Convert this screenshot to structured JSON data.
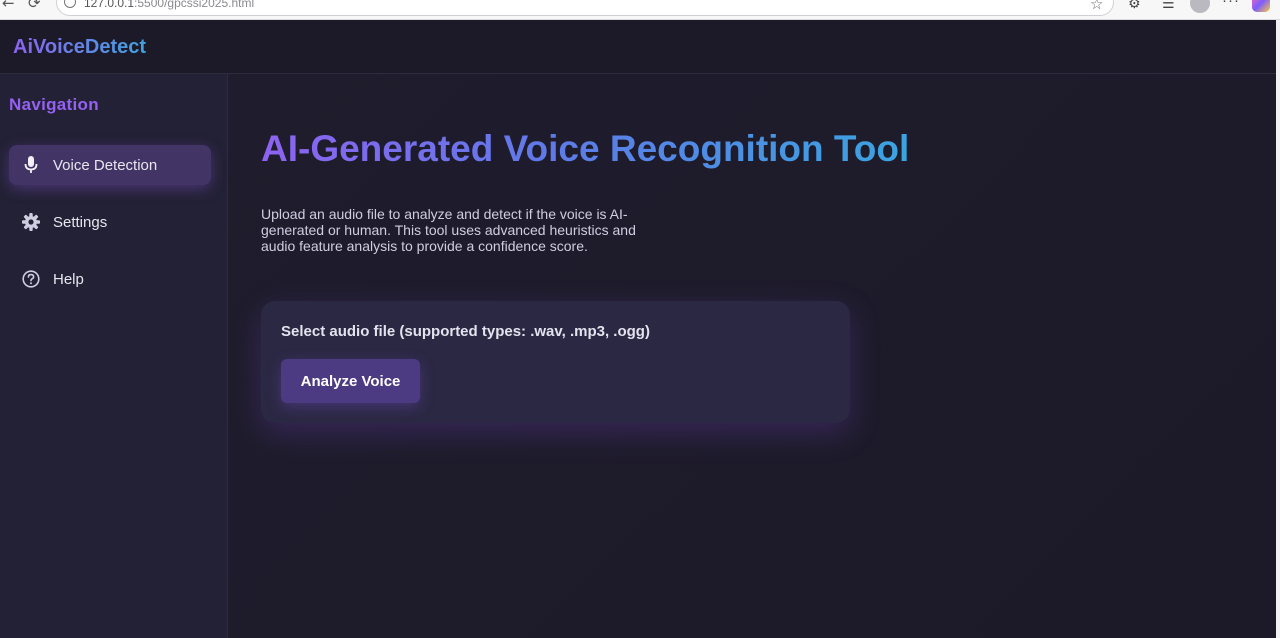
{
  "browser": {
    "url_host": "127.0.0.1",
    "url_rest": ":5500/gpcssi2025.html"
  },
  "brand": {
    "name": "AiVoiceDetect"
  },
  "sidebar": {
    "title": "Navigation",
    "items": [
      {
        "label": "Voice Detection",
        "icon": "microphone-icon",
        "active": true
      },
      {
        "label": "Settings",
        "icon": "gear-icon",
        "active": false
      },
      {
        "label": "Help",
        "icon": "help-icon",
        "active": false
      }
    ]
  },
  "main": {
    "title": "AI-Generated Voice Recognition Tool",
    "description": "Upload an audio file to analyze and detect if the voice is AI-generated or human. This tool uses advanced heuristics and audio feature analysis to provide a confidence score.",
    "upload": {
      "label": "Select audio file (supported types: .wav, .mp3, .ogg)",
      "button": "Analyze Voice"
    }
  },
  "colors": {
    "accent_purple": "#8d63f0",
    "accent_blue": "#3aa4e0",
    "background": "#1e1c2c",
    "sidebar_bg": "#232135",
    "button_bg": "#4c3a82"
  }
}
